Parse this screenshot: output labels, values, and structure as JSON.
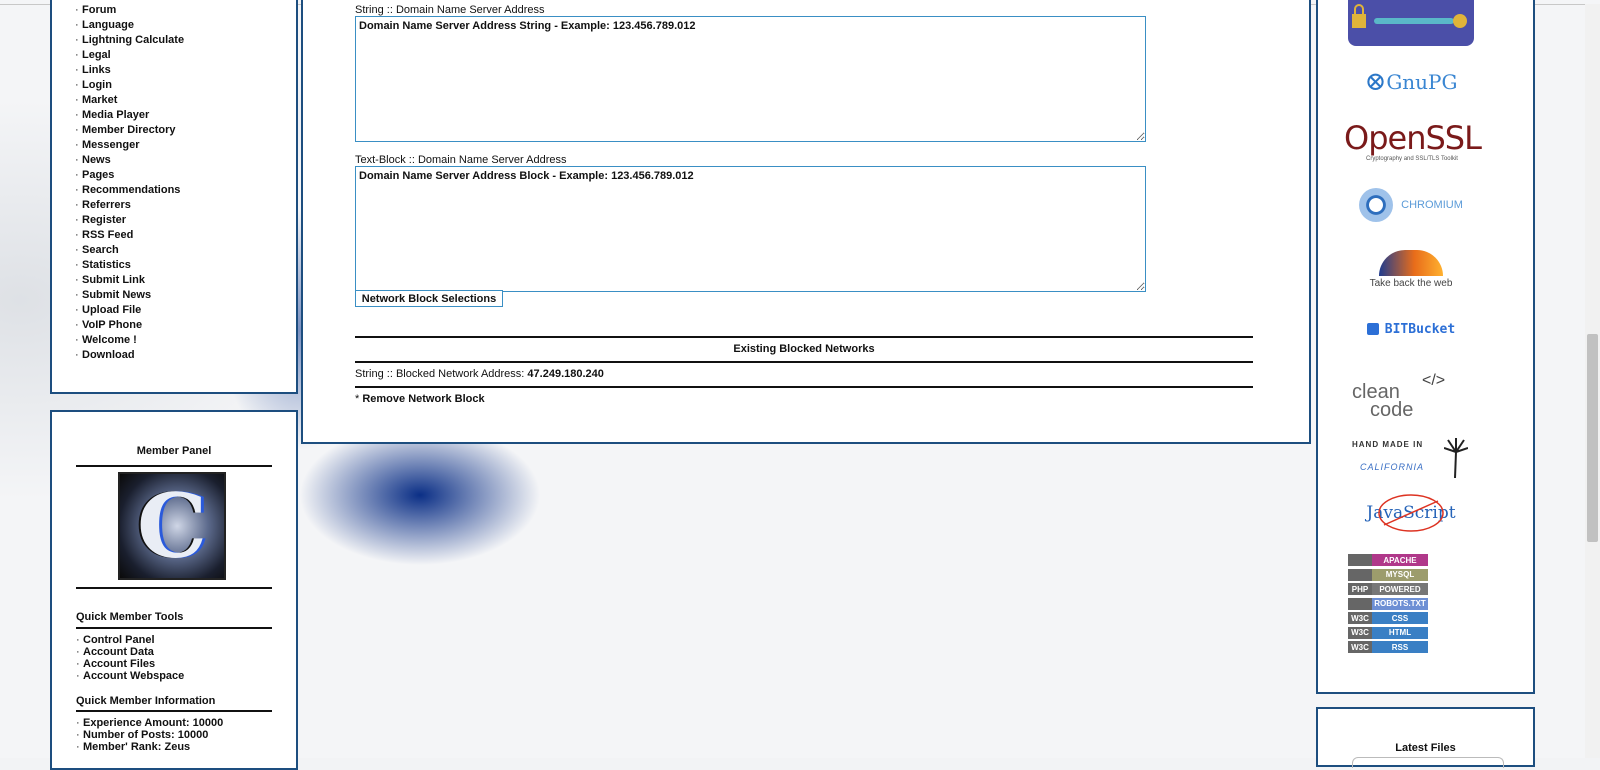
{
  "nav": {
    "items": [
      "Forum",
      "Language",
      "Lightning Calculate",
      "Legal",
      "Links",
      "Login",
      "Market",
      "Media Player",
      "Member Directory",
      "Messenger",
      "News",
      "Pages",
      "Recommendations",
      "Referrers",
      "Register",
      "RSS Feed",
      "Search",
      "Statistics",
      "Submit Link",
      "Submit News",
      "Upload File",
      "VoIP Phone",
      "Welcome !",
      "Download"
    ],
    "bullet": "·"
  },
  "member_panel": {
    "title": "Member Panel",
    "avatar_letter": "C",
    "tools_title": "Quick Member Tools",
    "tools": [
      "Control Panel",
      "Account Data",
      "Account Files",
      "Account Webspace"
    ],
    "info_title": "Quick Member Information",
    "info": [
      {
        "label": "Experience Amount:",
        "value": "10000"
      },
      {
        "label": "Number of Posts:",
        "value": "10000"
      },
      {
        "label": "Member' Rank:",
        "value": "Zeus"
      }
    ]
  },
  "main": {
    "string_label": "String :: Domain Name Server Address",
    "string_value": "Domain Name Server Address String - Example: 123.456.789.012",
    "block_label": "Text-Block :: Domain Name Server Address",
    "block_value": "Domain Name Server Address Block - Example: 123.456.789.012",
    "submit_label": "Network Block Selections",
    "existing_title": "Existing Blocked Networks",
    "blocked_prefix": "String :: Blocked Network Address:",
    "blocked_ip": "47.249.180.240",
    "remove_prefix": "*",
    "remove_label": "Remove Network Block"
  },
  "right": {
    "logos": {
      "gnupg": "GnuPG",
      "openssl_main": "OpenSSL",
      "openssl_sub": "Cryptography and SSL/TLS Toolkit",
      "chromium": "CHROMIUM",
      "firefox": "Take back the web",
      "bitbucket": "BITBucket",
      "cleancode_1": "clean",
      "cleancode_2": "code",
      "cleancode_tag": "</>",
      "handmade_1": "HAND MADE IN",
      "handmade_2": "CALIFORNIA",
      "javascript": "JavaScript"
    },
    "badges": [
      {
        "left": "",
        "right": "APACHE",
        "color": "#b0388a"
      },
      {
        "left": "",
        "right": "MYSQL",
        "color": "#9c9c6c"
      },
      {
        "left": "PHP",
        "right": "POWERED",
        "color": "#777"
      },
      {
        "left": "",
        "right": "ROBOTS.TXT",
        "color": "#6d8fd4"
      },
      {
        "left": "W3C",
        "right": "CSS",
        "color": "#3a7fc4"
      },
      {
        "left": "W3C",
        "right": "HTML",
        "color": "#3a7fc4"
      },
      {
        "left": "W3C",
        "right": "RSS",
        "color": "#3a7fc4"
      }
    ],
    "latest_files_title": "Latest Files"
  }
}
